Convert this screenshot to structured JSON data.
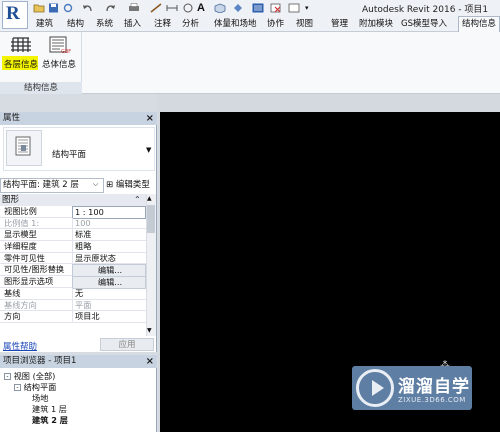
{
  "window": {
    "title": "Autodesk Revit 2016 -   项目1"
  },
  "app_menu": {
    "logo_letter": "R"
  },
  "menu_tabs": [
    "建筑",
    "结构",
    "系统",
    "插入",
    "注释",
    "分析",
    "体量和场地",
    "协作",
    "视图",
    "管理",
    "附加模块",
    "GS模型导入",
    "结构信息"
  ],
  "active_tab": "结构信息",
  "ribbon": {
    "buttons": [
      {
        "label": "各层信息",
        "icon": "floor-table-icon",
        "highlighted": true
      },
      {
        "label": "总体信息",
        "icon": "general-info-icon",
        "highlighted": false
      }
    ],
    "panel_title": "结构信息"
  },
  "properties": {
    "title": "属性",
    "type_name": "结构平面",
    "selector_value": "结构平面: 建筑 2 层",
    "edit_type": "编辑类型",
    "group": "图形",
    "rows": [
      {
        "key": "视图比例",
        "value": "1 : 100",
        "style": "box"
      },
      {
        "key": "比例值 1:",
        "value": "100",
        "style": "dim"
      },
      {
        "key": "显示模型",
        "value": "标准",
        "style": ""
      },
      {
        "key": "详细程度",
        "value": "粗略",
        "style": ""
      },
      {
        "key": "零件可见性",
        "value": "显示原状态",
        "style": ""
      },
      {
        "key": "可见性/图形替换",
        "value": "编辑...",
        "style": "btn"
      },
      {
        "key": "图形显示选项",
        "value": "编辑...",
        "style": "btn"
      },
      {
        "key": "基线",
        "value": "无",
        "style": ""
      },
      {
        "key": "基线方向",
        "value": "平面",
        "style": "dim"
      },
      {
        "key": "方向",
        "value": "项目北",
        "style": ""
      }
    ],
    "help_link": "属性帮助",
    "apply": "应用"
  },
  "browser": {
    "title": "项目浏览器 - 项目1",
    "tree": [
      {
        "label": "视图 (全部)",
        "level": 0,
        "toggle": "-",
        "bold": false
      },
      {
        "label": "结构平面",
        "level": 1,
        "toggle": "-",
        "bold": false
      },
      {
        "label": "场地",
        "level": 2,
        "toggle": "",
        "bold": false
      },
      {
        "label": "建筑 1 层",
        "level": 2,
        "toggle": "",
        "bold": false
      },
      {
        "label": "建筑 2 层",
        "level": 2,
        "toggle": "",
        "bold": true
      }
    ]
  },
  "watermark": {
    "title": "溜溜自学",
    "subtitle": "ZIXUE.3D66.COM"
  },
  "colors": {
    "canvas": "#000000",
    "highlight": "#f4f400",
    "link": "#1b46b8"
  }
}
